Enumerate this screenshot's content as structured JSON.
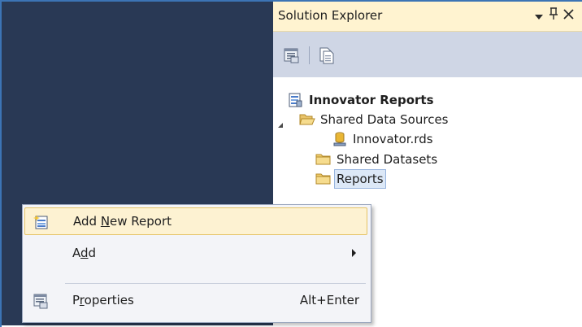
{
  "solution_explorer": {
    "title": "Solution Explorer",
    "pin_glyph": "↕",
    "close_glyph": "✕",
    "tree": {
      "project": "Innovator Reports",
      "shared_data_sources": "Shared Data Sources",
      "data_source_file": "Innovator.rds",
      "shared_datasets": "Shared Datasets",
      "reports": "Reports"
    }
  },
  "context_menu": {
    "items": [
      {
        "label_pre": "Add ",
        "mnemonic": "N",
        "label_post": "ew Report",
        "shortcut": ""
      },
      {
        "label_pre": "A",
        "mnemonic": "d",
        "label_post": "d",
        "shortcut": ""
      },
      {
        "label_pre": "P",
        "mnemonic": "r",
        "label_post": "operties",
        "shortcut": "Alt+Enter"
      }
    ]
  },
  "colors": {
    "workspace_bg": "#293955",
    "panel_header_bg": "#fff3d0",
    "toolbar_bg": "#cfd6e5",
    "menu_highlight": "#fdf2d2"
  }
}
